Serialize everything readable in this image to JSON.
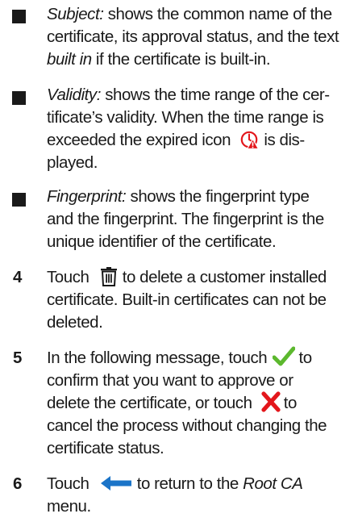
{
  "bullets": [
    {
      "label": "Subject:",
      "line1_rest": " shows the common name of the",
      "line2": "certificate, its approval status, and the text",
      "line3_italic": "built in",
      "line3_rest": " if the certificate is built-in."
    },
    {
      "label": "Validity:",
      "line1_rest": " shows the time range of the cer-",
      "line2": "tificate’s validity. When the time range is",
      "line3_a": "exceeded the expired icon",
      "line3_b": "is dis-",
      "line4": "played."
    },
    {
      "label": "Fingerprint:",
      "line1_rest": " shows the fingerprint type",
      "line2": "and the fingerprint. The fingerprint is the",
      "line3": "unique identifier of the certificate."
    }
  ],
  "steps": [
    {
      "number": "4",
      "line1_a": "Touch",
      "line1_b": "to delete a customer installed",
      "line2": "certificate. Built-in certificates can not be",
      "line3": "deleted."
    },
    {
      "number": "5",
      "line1_a": "In the following message, touch",
      "line1_b": "to",
      "line2": "confirm that you want to approve or",
      "line3_a": "delete the certificate, or touch",
      "line3_b": "to",
      "line4": "cancel the process without changing the",
      "line5": "certificate status."
    },
    {
      "number": "6",
      "line1_a": "Touch",
      "line1_b": "to return to the",
      "line1_italic": "Root CA",
      "line2": "menu."
    }
  ],
  "icons": {
    "expired": "expired-certificate-icon",
    "delete": "trash-icon",
    "confirm": "checkmark-icon",
    "cancel": "cancel-x-icon",
    "back": "back-arrow-icon"
  },
  "colors": {
    "text": "#1a1a1a",
    "confirm_green": "#5cb82e",
    "cancel_red": "#e3161b",
    "back_blue": "#1b74c8",
    "expired_red": "#e3161b"
  }
}
